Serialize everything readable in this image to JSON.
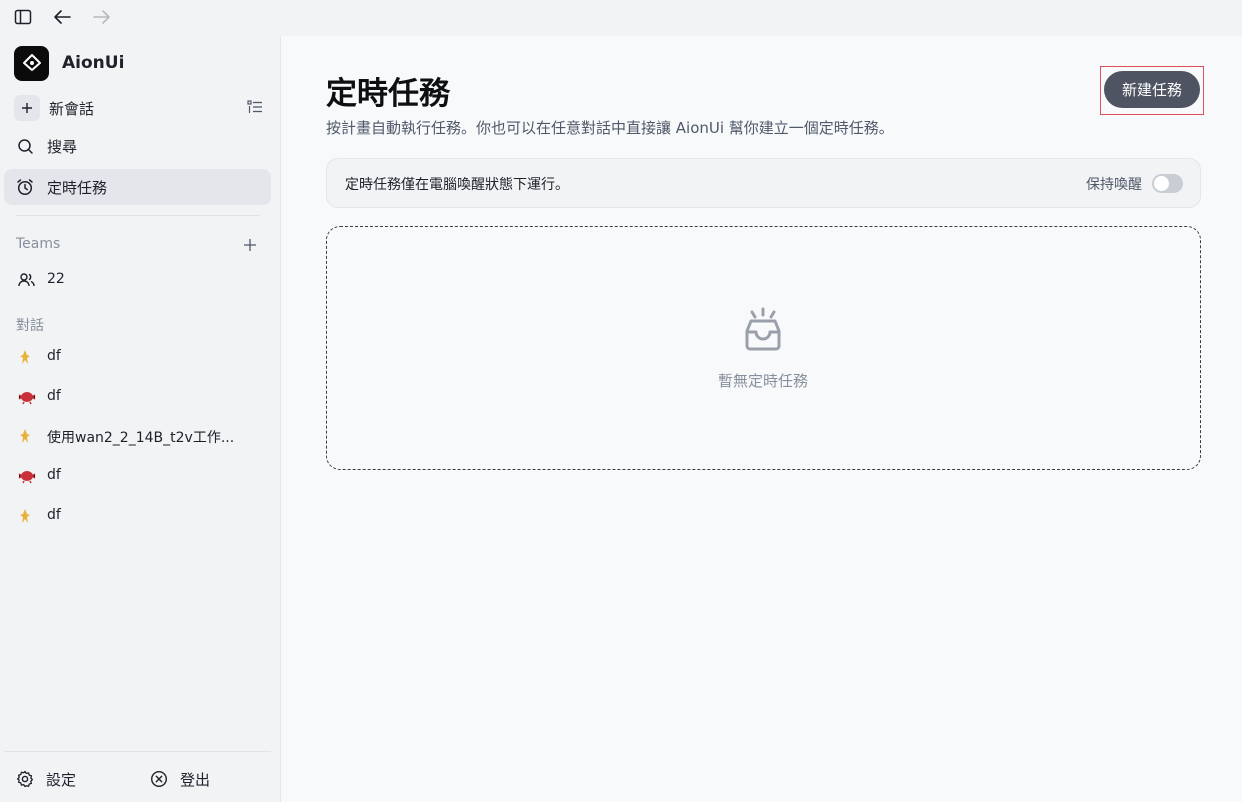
{
  "sidebar": {
    "brand": "AionUi",
    "new_chat": "新會話",
    "search": "搜尋",
    "scheduled": "定時任務",
    "teams_title": "Teams",
    "teams": [
      {
        "label": "22"
      }
    ],
    "conversations_title": "對話",
    "conversations": [
      {
        "label": "df",
        "icon": "yellow-agent-icon"
      },
      {
        "label": "df",
        "icon": "red-agent-icon"
      },
      {
        "label": "使用wan2_2_14B_t2v工作...",
        "icon": "yellow-agent-icon"
      },
      {
        "label": "df",
        "icon": "red-agent-icon"
      },
      {
        "label": "df",
        "icon": "yellow-agent-icon"
      }
    ],
    "settings": "設定",
    "logout": "登出"
  },
  "main": {
    "title": "定時任務",
    "description": "按計畫自動執行任務。你也可以在任意對話中直接讓 AionUi 幫你建立一個定時任務。",
    "new_task_button": "新建任務",
    "notice": "定時任務僅在電腦喚醒狀態下運行。",
    "keep_awake_label": "保持喚醒",
    "keep_awake_on": false,
    "empty_text": "暫無定時任務"
  },
  "colors": {
    "accent_button": "#4e5461",
    "highlight_border": "#e0505a",
    "agent_yellow": "#e7b23a",
    "agent_red": "#c8303a"
  }
}
